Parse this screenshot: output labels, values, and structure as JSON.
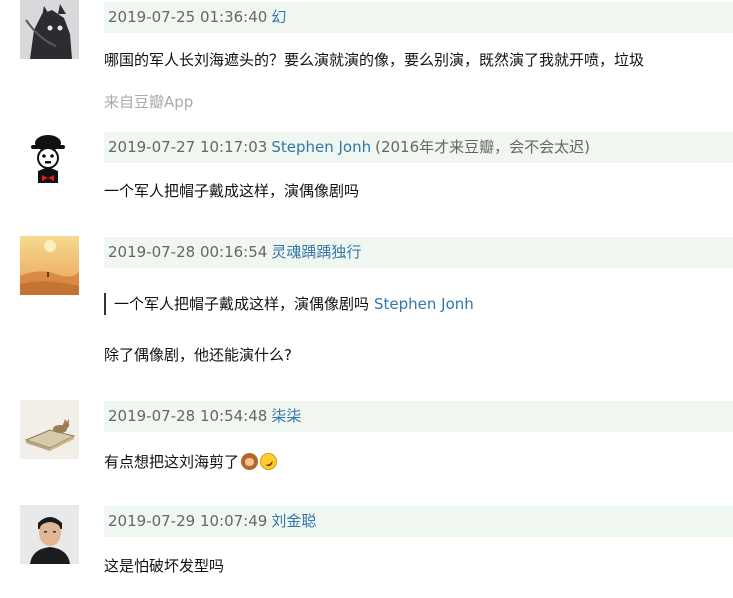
{
  "comments": [
    {
      "timestamp": "2019-07-25 01:36:40",
      "user": "幻",
      "text": "哪国的军人长刘海遮头的？要么演就演的像，要么别演，既然演了我就开喷，垃圾",
      "source": "来自豆瓣App",
      "avatar_icon": "cat-avatar"
    },
    {
      "timestamp": "2019-07-27 10:17:03",
      "user": "Stephen Jonh",
      "extra": "(2016年才来豆瓣，会不会太迟)",
      "text": "一个军人把帽子戴成这样，演偶像剧吗",
      "avatar_icon": "chaplin-avatar"
    },
    {
      "timestamp": "2019-07-28 00:16:54",
      "user": "灵魂踽踽独行",
      "quote": {
        "text": "一个军人把帽子戴成这样，演偶像剧吗",
        "user": "Stephen Jonh"
      },
      "text": "除了偶像剧，他还能演什么?",
      "avatar_icon": "desert-avatar"
    },
    {
      "timestamp": "2019-07-28 10:54:48",
      "user": "柒柒",
      "text": "有点想把这刘海剪了",
      "emojis": [
        "see-no-evil-monkey-emoji",
        "rolling-laughing-emoji"
      ],
      "avatar_icon": "cat-on-book-avatar"
    },
    {
      "timestamp": "2019-07-29 10:07:49",
      "user": "刘金聪",
      "text": "这是怕破坏发型吗",
      "avatar_icon": "person-avatar"
    }
  ]
}
